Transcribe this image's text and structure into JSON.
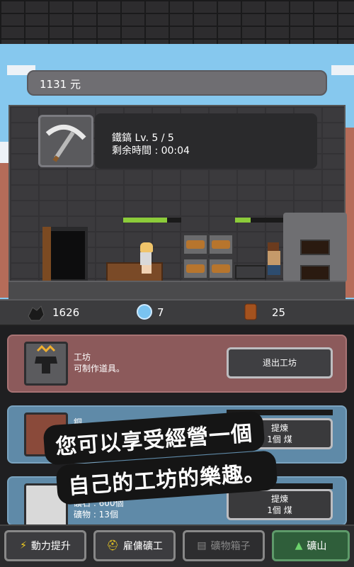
{
  "header": {
    "money": "1131 元"
  },
  "tool": {
    "name_line": "鐵鎬 Lv. 5 / 5",
    "time_line": "剩余時間 : 00:04",
    "icon": "pickaxe-icon"
  },
  "stats": {
    "coal": {
      "icon": "coal-icon",
      "value": "1626"
    },
    "gem": {
      "icon": "gem-icon",
      "value": "7"
    },
    "wood": {
      "icon": "wood-icon",
      "value": "25"
    }
  },
  "workshop_card": {
    "icon": "anvil-icon",
    "title": "工坊",
    "desc": "可制作道具。",
    "button": "退出工坊"
  },
  "copper_card": {
    "icon": "copper-ore-icon",
    "title": "銅",
    "button_line1": "提煉",
    "button_line2": "1個 煤"
  },
  "silver_card": {
    "icon": "silver-ore-icon",
    "line1": "礦石 : 600個",
    "line2": "礦物 : 13個",
    "button_line1": "提煉",
    "button_line2": "1個 煤"
  },
  "banner": {
    "line1": "您可以享受經營一個",
    "line2": "自己的工坊的樂趣。"
  },
  "nav": {
    "boost": "動力提升",
    "hire": "雇傭礦工",
    "chest": "礦物箱子",
    "mine": "礦山"
  },
  "colors": {
    "accent_green": "#8ccc3a",
    "card_red": "#8c5a5b",
    "card_blue": "#5f8aa8"
  }
}
